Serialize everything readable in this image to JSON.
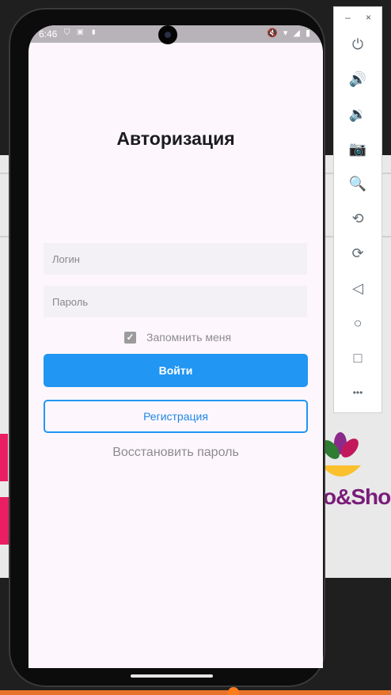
{
  "statusbar": {
    "time": "6:46",
    "left_icons": "⛉ ▣ ▮",
    "right_icons": "🔇 ▾ ◢ ▮"
  },
  "app": {
    "title": "Авторизация",
    "login_placeholder": "Логин",
    "password_placeholder": "Пароль",
    "remember_me_label": "Запомнить меня",
    "remember_checked": true,
    "login_button": "Войти",
    "register_button": "Регистрация",
    "restore_link": "Восстановить пароль"
  },
  "emulator_toolbar": {
    "minimize": "–",
    "close": "×",
    "buttons": [
      {
        "icon": "power-icon",
        "glyph": "⏻"
      },
      {
        "icon": "volume-up-icon",
        "glyph": "🔊"
      },
      {
        "icon": "volume-down-icon",
        "glyph": "🔉"
      },
      {
        "icon": "camera-icon",
        "glyph": "📷"
      },
      {
        "icon": "zoom-icon",
        "glyph": "🔍"
      },
      {
        "icon": "rotate-left-icon",
        "glyph": "⟲"
      },
      {
        "icon": "rotate-right-icon",
        "glyph": "⟳"
      },
      {
        "icon": "back-icon",
        "glyph": "◁"
      },
      {
        "icon": "home-icon",
        "glyph": "○"
      },
      {
        "icon": "overview-icon",
        "glyph": "□"
      },
      {
        "icon": "more-icon",
        "glyph": "•••"
      }
    ]
  },
  "background": {
    "shop_text": "o&Shop"
  },
  "colors": {
    "primary": "#2196f3",
    "screen_bg": "#fdf7fd",
    "field_bg": "#f3f1f5"
  }
}
